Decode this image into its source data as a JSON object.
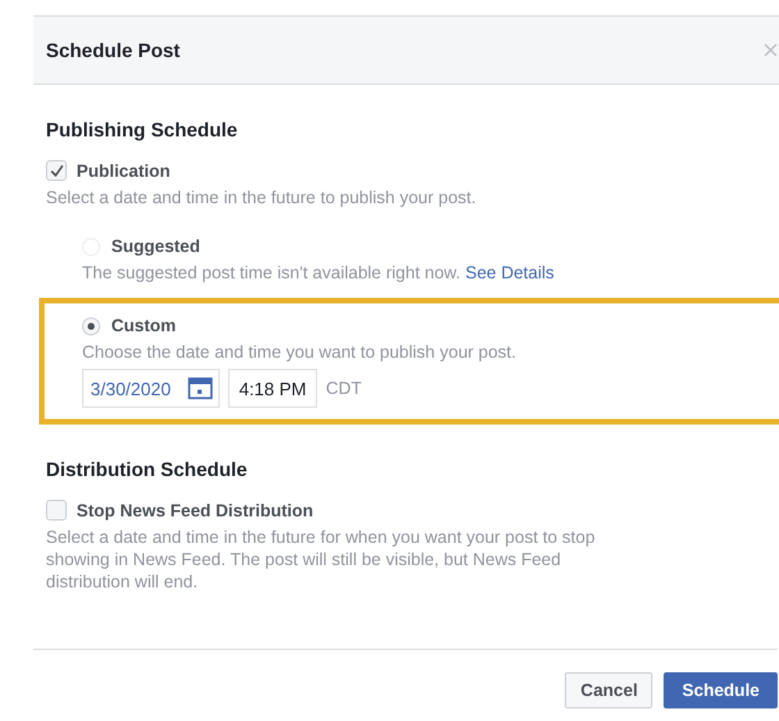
{
  "dialog": {
    "title": "Schedule Post",
    "publishing": {
      "heading": "Publishing Schedule",
      "publication": {
        "label": "Publication",
        "checked": true,
        "description": "Select a date and time in the future to publish your post."
      },
      "options": [
        {
          "kind": "suggested",
          "label": "Suggested",
          "selected": false,
          "disabled": true,
          "highlighted": false,
          "description": "The suggested post time isn't available right now.",
          "link": "See Details"
        },
        {
          "kind": "custom",
          "label": "Custom",
          "selected": true,
          "disabled": false,
          "highlighted": true,
          "description": "Choose the date and time you want to publish your post.",
          "date": "3/30/2020",
          "time": "4:18 PM",
          "timezone": "CDT"
        }
      ]
    },
    "distribution": {
      "heading": "Distribution Schedule",
      "stop": {
        "label": "Stop News Feed Distribution",
        "checked": false,
        "description": "Select a date and time in the future for when you want your post to stop showing in News Feed. The post will still be visible, but News Feed distribution will end."
      }
    },
    "buttons": [
      {
        "kind": "secondary",
        "label": "Cancel"
      },
      {
        "kind": "primary",
        "label": "Schedule"
      }
    ]
  }
}
